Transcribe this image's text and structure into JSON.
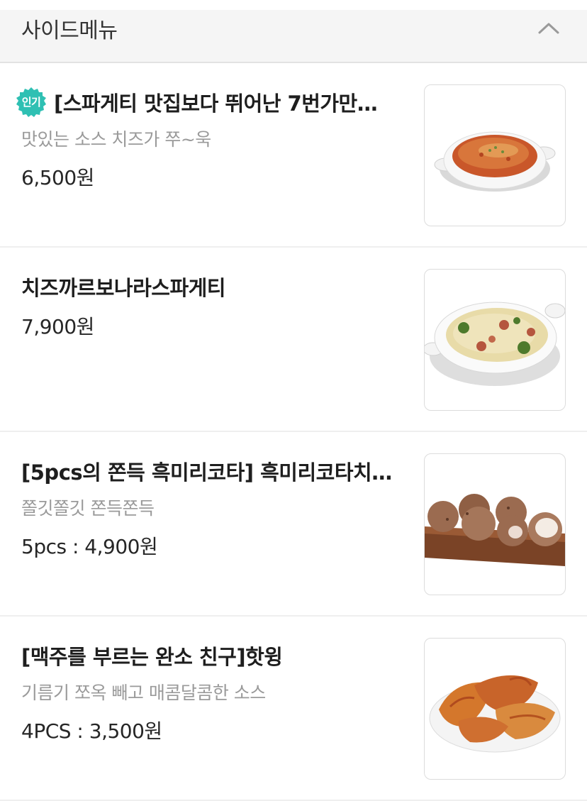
{
  "section": {
    "title": "사이드메뉴",
    "collapse_icon": "chevron-up-icon"
  },
  "badge_color": "#2fc0b3",
  "items": [
    {
      "badge": "인기",
      "name": "[스파게티 맛집보다 뛰어난 7번가만…",
      "desc": "맛있는 소스  치즈가 쭈~욱",
      "price": "6,500원",
      "image": "baked-spaghetti-dish-image"
    },
    {
      "name": "치즈까르보나라스파게티",
      "price": "7,900원",
      "image": "cheese-carbonara-dish-image"
    },
    {
      "name": "[5pcs의 쫀득 흑미리코타] 흑미리코타치…",
      "desc": "쫄깃쫄깃  쫀득쫀득",
      "price": "5pcs : 4,900원",
      "image": "black-rice-ricotta-balls-image"
    },
    {
      "name": "[맥주를 부르는 완소 친구]핫윙",
      "desc": "기름기 쪼옥 빼고   매콤달콤한 소스",
      "price": "4PCS : 3,500원",
      "image": "hot-wings-plate-image"
    }
  ]
}
